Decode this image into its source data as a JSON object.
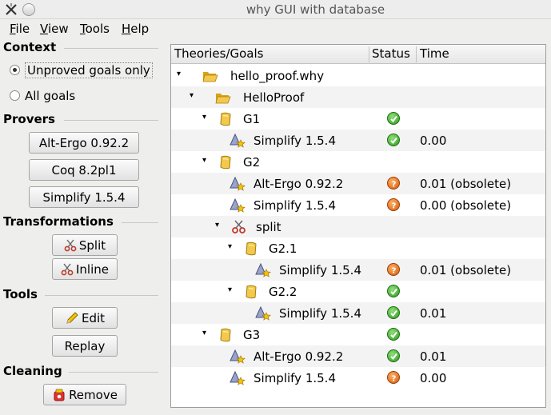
{
  "window": {
    "title": "why GUI with database"
  },
  "menu": [
    "File",
    "View",
    "Tools",
    "Help"
  ],
  "left": {
    "context": {
      "heading": "Context",
      "options": [
        "Unproved goals only",
        "All goals"
      ],
      "selected": 0
    },
    "provers": {
      "heading": "Provers",
      "buttons": [
        "Alt-Ergo 0.92.2",
        "Coq 8.2pl1",
        "Simplify 1.5.4"
      ]
    },
    "transformations": {
      "heading": "Transformations",
      "buttons": [
        "Split",
        "Inline"
      ]
    },
    "tools": {
      "heading": "Tools",
      "buttons": [
        "Edit",
        "Replay"
      ]
    },
    "cleaning": {
      "heading": "Cleaning",
      "buttons": [
        "Remove"
      ]
    }
  },
  "tree": {
    "columns": [
      "Theories/Goals",
      "Status",
      "Time"
    ],
    "rows": [
      {
        "depth": 0,
        "expander": true,
        "icon": "folder-open-icon",
        "name": "hello_proof.why",
        "status": "",
        "time": ""
      },
      {
        "depth": 1,
        "expander": true,
        "icon": "folder-open-icon",
        "name": "HelloProof",
        "status": "",
        "time": ""
      },
      {
        "depth": 2,
        "expander": true,
        "icon": "goal-icon",
        "name": "G1",
        "status": "valid",
        "time": ""
      },
      {
        "depth": 3,
        "expander": false,
        "icon": "prover-icon",
        "name": "Simplify 1.5.4",
        "status": "valid",
        "time": "0.00"
      },
      {
        "depth": 2,
        "expander": true,
        "icon": "goal-icon",
        "name": "G2",
        "status": "",
        "time": ""
      },
      {
        "depth": 3,
        "expander": false,
        "icon": "prover-icon",
        "name": "Alt-Ergo 0.92.2",
        "status": "obsolete",
        "time": "0.01 (obsolete)"
      },
      {
        "depth": 3,
        "expander": false,
        "icon": "prover-icon",
        "name": "Simplify 1.5.4",
        "status": "obsolete",
        "time": "0.00 (obsolete)"
      },
      {
        "depth": 3,
        "expander": true,
        "icon": "scissors-icon",
        "name": "split",
        "status": "",
        "time": ""
      },
      {
        "depth": 4,
        "expander": true,
        "icon": "goal-icon",
        "name": "G2.1",
        "status": "",
        "time": ""
      },
      {
        "depth": 5,
        "expander": false,
        "icon": "prover-icon",
        "name": "Simplify 1.5.4",
        "status": "obsolete",
        "time": "0.01 (obsolete)"
      },
      {
        "depth": 4,
        "expander": true,
        "icon": "goal-icon",
        "name": "G2.2",
        "status": "valid",
        "time": ""
      },
      {
        "depth": 5,
        "expander": false,
        "icon": "prover-icon",
        "name": "Simplify 1.5.4",
        "status": "valid",
        "time": "0.01"
      },
      {
        "depth": 2,
        "expander": true,
        "icon": "goal-icon",
        "name": "G3",
        "status": "valid",
        "time": ""
      },
      {
        "depth": 3,
        "expander": false,
        "icon": "prover-icon",
        "name": "Alt-Ergo 0.92.2",
        "status": "valid",
        "time": "0.01"
      },
      {
        "depth": 3,
        "expander": false,
        "icon": "prover-icon",
        "name": "Simplify 1.5.4",
        "status": "obsolete",
        "time": "0.00"
      }
    ]
  },
  "colors": {
    "valid": "#2f9a1c",
    "obsolete": "#d35b0a",
    "folder": "#e8b52a"
  }
}
